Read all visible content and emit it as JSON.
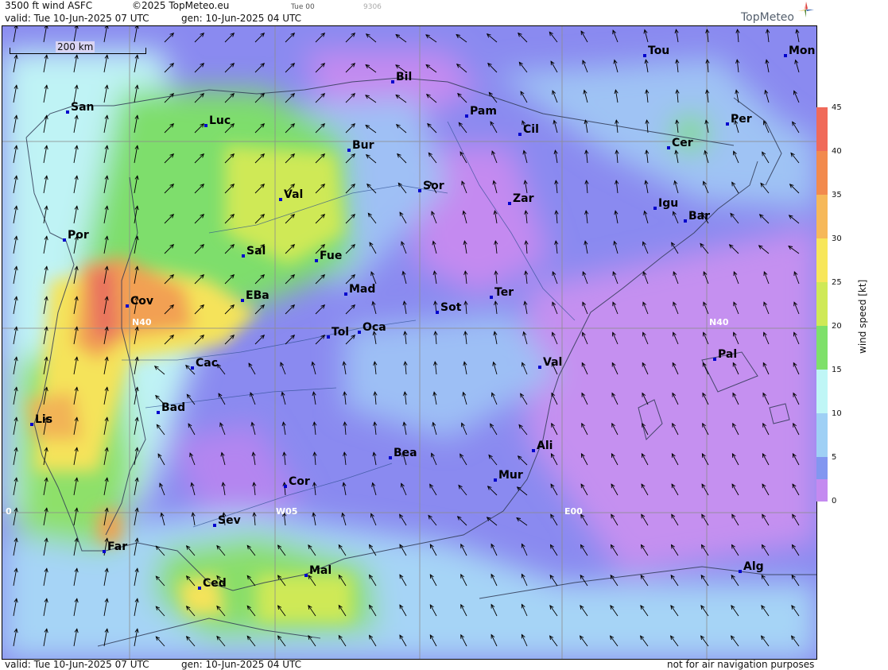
{
  "header": {
    "product": "3500 ft wind ASFC",
    "copyright": "©2025 TopMeteo.eu",
    "run_label": "Tue 00",
    "run_code": "9306",
    "valid": "valid:  Tue  10-Jun-2025  07 UTC",
    "gen": "gen: 10-Jun-2025 04 UTC",
    "logo": "TopMeteo"
  },
  "scale": {
    "label": "200 km"
  },
  "grid": {
    "n40_left": "N40",
    "n40_right": "N40",
    "w05": "W05",
    "e00": "E00",
    "zero": "0"
  },
  "cities": [
    {
      "name": "San"
    },
    {
      "name": "Bil"
    },
    {
      "name": "Tou"
    },
    {
      "name": "Mon"
    },
    {
      "name": "Luc"
    },
    {
      "name": "Pam"
    },
    {
      "name": "Cil"
    },
    {
      "name": "Per"
    },
    {
      "name": "Bur"
    },
    {
      "name": "Cer"
    },
    {
      "name": "Sor"
    },
    {
      "name": "Val"
    },
    {
      "name": "Zar"
    },
    {
      "name": "Igu"
    },
    {
      "name": "Bar"
    },
    {
      "name": "Por"
    },
    {
      "name": "Sal"
    },
    {
      "name": "Fue"
    },
    {
      "name": "Mad"
    },
    {
      "name": "Cov"
    },
    {
      "name": "EBa"
    },
    {
      "name": "Sot"
    },
    {
      "name": "Ter"
    },
    {
      "name": "Tol"
    },
    {
      "name": "Oca"
    },
    {
      "name": "Pal"
    },
    {
      "name": "Cac"
    },
    {
      "name": "Val"
    },
    {
      "name": "Bad"
    },
    {
      "name": "Lis"
    },
    {
      "name": "Ali"
    },
    {
      "name": "Bea"
    },
    {
      "name": "Mur"
    },
    {
      "name": "Cor"
    },
    {
      "name": "Sev"
    },
    {
      "name": "Far"
    },
    {
      "name": "Mal"
    },
    {
      "name": "Alg"
    },
    {
      "name": "Ced"
    }
  ],
  "legend": {
    "title": "wind speed  [kt]",
    "ticks": [
      "45",
      "40",
      "35",
      "30",
      "25",
      "20",
      "15",
      "10",
      "5",
      "0"
    ],
    "colors": [
      "#f06a5a",
      "#f28a4e",
      "#f6b85a",
      "#f7e65a",
      "#cfe956",
      "#7ee06a",
      "#bff6f6",
      "#9fd0f5",
      "#8296f0",
      "#7d6de8",
      "#c48af0"
    ]
  },
  "footer": {
    "valid": "valid:  Tue  10-Jun-2025  07 UTC",
    "gen": "gen: 10-Jun-2025 04 UTC",
    "note": "not for air navigation purposes"
  }
}
